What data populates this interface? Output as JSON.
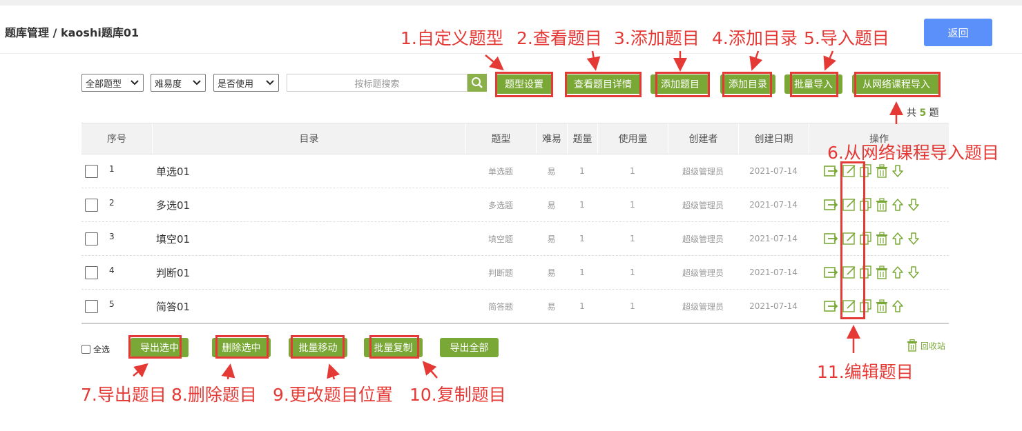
{
  "header": {
    "breadcrumb": "题库管理 / kaoshi题库01",
    "back_label": "返回"
  },
  "filters": {
    "type_select": "全部题型",
    "difficulty_select": "难易度",
    "usage_select": "是否使用",
    "search_placeholder": "按标题搜索"
  },
  "toolbar": {
    "type_settings": "题型设置",
    "view_details": "查看题目详情",
    "add_question": "添加题目",
    "add_directory": "添加目录",
    "batch_import": "批量导入",
    "import_from_course": "从网络课程导入"
  },
  "total": {
    "prefix": "共",
    "count": "5",
    "suffix": "题"
  },
  "table": {
    "headers": [
      "序号",
      "目录",
      "题型",
      "难易",
      "题量",
      "使用量",
      "创建者",
      "创建日期",
      "操作"
    ],
    "rows": [
      {
        "no": "1",
        "name": "单选01",
        "type": "单选题",
        "difficulty": "易",
        "count": "1",
        "usage": "1",
        "creator": "超级管理员",
        "date": "2021-07-14"
      },
      {
        "no": "2",
        "name": "多选01",
        "type": "多选题",
        "difficulty": "易",
        "count": "1",
        "usage": "1",
        "creator": "超级管理员",
        "date": "2021-07-14"
      },
      {
        "no": "3",
        "name": "填空01",
        "type": "填空题",
        "difficulty": "易",
        "count": "1",
        "usage": "1",
        "creator": "超级管理员",
        "date": "2021-07-14"
      },
      {
        "no": "4",
        "name": "判断01",
        "type": "判断题",
        "difficulty": "易",
        "count": "1",
        "usage": "1",
        "creator": "超级管理员",
        "date": "2021-07-14"
      },
      {
        "no": "5",
        "name": "简答01",
        "type": "简答题",
        "difficulty": "易",
        "count": "1",
        "usage": "1",
        "creator": "超级管理员",
        "date": "2021-07-14"
      }
    ],
    "row_actions": [
      "move-icon",
      "edit-icon",
      "copy-icon",
      "delete-icon",
      "move-up-icon",
      "move-down-icon"
    ]
  },
  "footer": {
    "select_all": "全选",
    "export_selected": "导出选中",
    "delete_selected": "删除选中",
    "batch_move": "批量移动",
    "batch_copy": "批量复制",
    "export_all": "导出全部",
    "recycle_bin": "回收站"
  },
  "annotations": {
    "a1": "1.自定义题型",
    "a2": "2.查看题目",
    "a3": "3.添加题目",
    "a4": "4.添加目录",
    "a5": "5.导入题目",
    "a6": "6.从网络课程导入题目",
    "a7": "7.导出题目",
    "a8": "8.删除题目",
    "a9": "9.更改题目位置",
    "a10": "10.复制题目",
    "a11": "11.编辑题目"
  },
  "colors": {
    "accent_green": "#7aa836",
    "primary_blue": "#5b8ff9",
    "annotation_red": "#e53935"
  }
}
